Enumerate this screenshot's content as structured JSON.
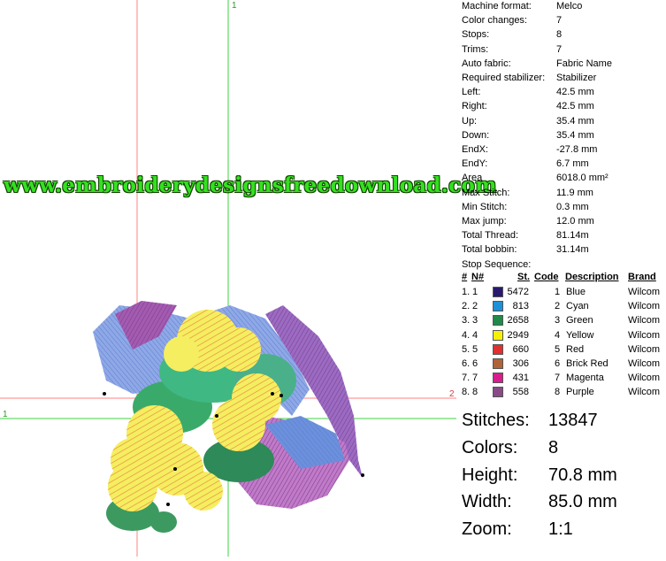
{
  "canvas": {
    "guide_label_top": "1",
    "guide_label_left": "1",
    "guide_label_right": "2",
    "watermark": "www.embroiderydesignsfreedownload.com"
  },
  "properties": [
    {
      "key": "Machine format:",
      "value": "Melco"
    },
    {
      "key": "Color changes:",
      "value": "7"
    },
    {
      "key": "Stops:",
      "value": "8"
    },
    {
      "key": "Trims:",
      "value": "7"
    },
    {
      "key": "Auto fabric:",
      "value": "Fabric Name"
    },
    {
      "key": "Required stabilizer:",
      "value": "Stabilizer"
    },
    {
      "key": "Left:",
      "value": "42.5 mm"
    },
    {
      "key": "Right:",
      "value": "42.5 mm"
    },
    {
      "key": "Up:",
      "value": "35.4 mm"
    },
    {
      "key": "Down:",
      "value": "35.4 mm"
    },
    {
      "key": "EndX:",
      "value": "-27.8 mm"
    },
    {
      "key": "EndY:",
      "value": "6.7 mm"
    },
    {
      "key": "Area",
      "value": "6018.0 mm²"
    },
    {
      "key": "Max Stitch:",
      "value": "11.9 mm"
    },
    {
      "key": "Min Stitch:",
      "value": "0.3 mm"
    },
    {
      "key": "Max jump:",
      "value": "12.0 mm"
    },
    {
      "key": "Total Thread:",
      "value": "81.14m"
    },
    {
      "key": "Total bobbin:",
      "value": "31.14m"
    },
    {
      "key": "Stop Sequence:",
      "value": ""
    }
  ],
  "stop_table": {
    "headers": {
      "num": "#",
      "n": "N#",
      "st": "St.",
      "code": "Code",
      "desc": "Description",
      "brand": "Brand"
    },
    "rows": [
      {
        "num": "1.",
        "n": "1",
        "color": "#2a1a6e",
        "st": "5472",
        "code": "1",
        "desc": "Blue",
        "brand": "Wilcom"
      },
      {
        "num": "2.",
        "n": "2",
        "color": "#1e90d8",
        "st": "813",
        "code": "2",
        "desc": "Cyan",
        "brand": "Wilcom"
      },
      {
        "num": "3.",
        "n": "3",
        "color": "#1f8a4a",
        "st": "2658",
        "code": "3",
        "desc": "Green",
        "brand": "Wilcom"
      },
      {
        "num": "4.",
        "n": "4",
        "color": "#f5f00a",
        "st": "2949",
        "code": "4",
        "desc": "Yellow",
        "brand": "Wilcom"
      },
      {
        "num": "5.",
        "n": "5",
        "color": "#e03030",
        "st": "660",
        "code": "5",
        "desc": "Red",
        "brand": "Wilcom"
      },
      {
        "num": "6.",
        "n": "6",
        "color": "#b0643a",
        "st": "306",
        "code": "6",
        "desc": "Brick Red",
        "brand": "Wilcom"
      },
      {
        "num": "7.",
        "n": "7",
        "color": "#d81e8c",
        "st": "431",
        "code": "7",
        "desc": "Magenta",
        "brand": "Wilcom"
      },
      {
        "num": "8.",
        "n": "8",
        "color": "#8a4a86",
        "st": "558",
        "code": "8",
        "desc": "Purple",
        "brand": "Wilcom"
      }
    ]
  },
  "summary": [
    {
      "key": "Stitches:",
      "value": "13847"
    },
    {
      "key": "Colors:",
      "value": "8"
    },
    {
      "key": "Height:",
      "value": "70.8 mm"
    },
    {
      "key": "Width:",
      "value": "85.0 mm"
    },
    {
      "key": "Zoom:",
      "value": "1:1"
    }
  ]
}
